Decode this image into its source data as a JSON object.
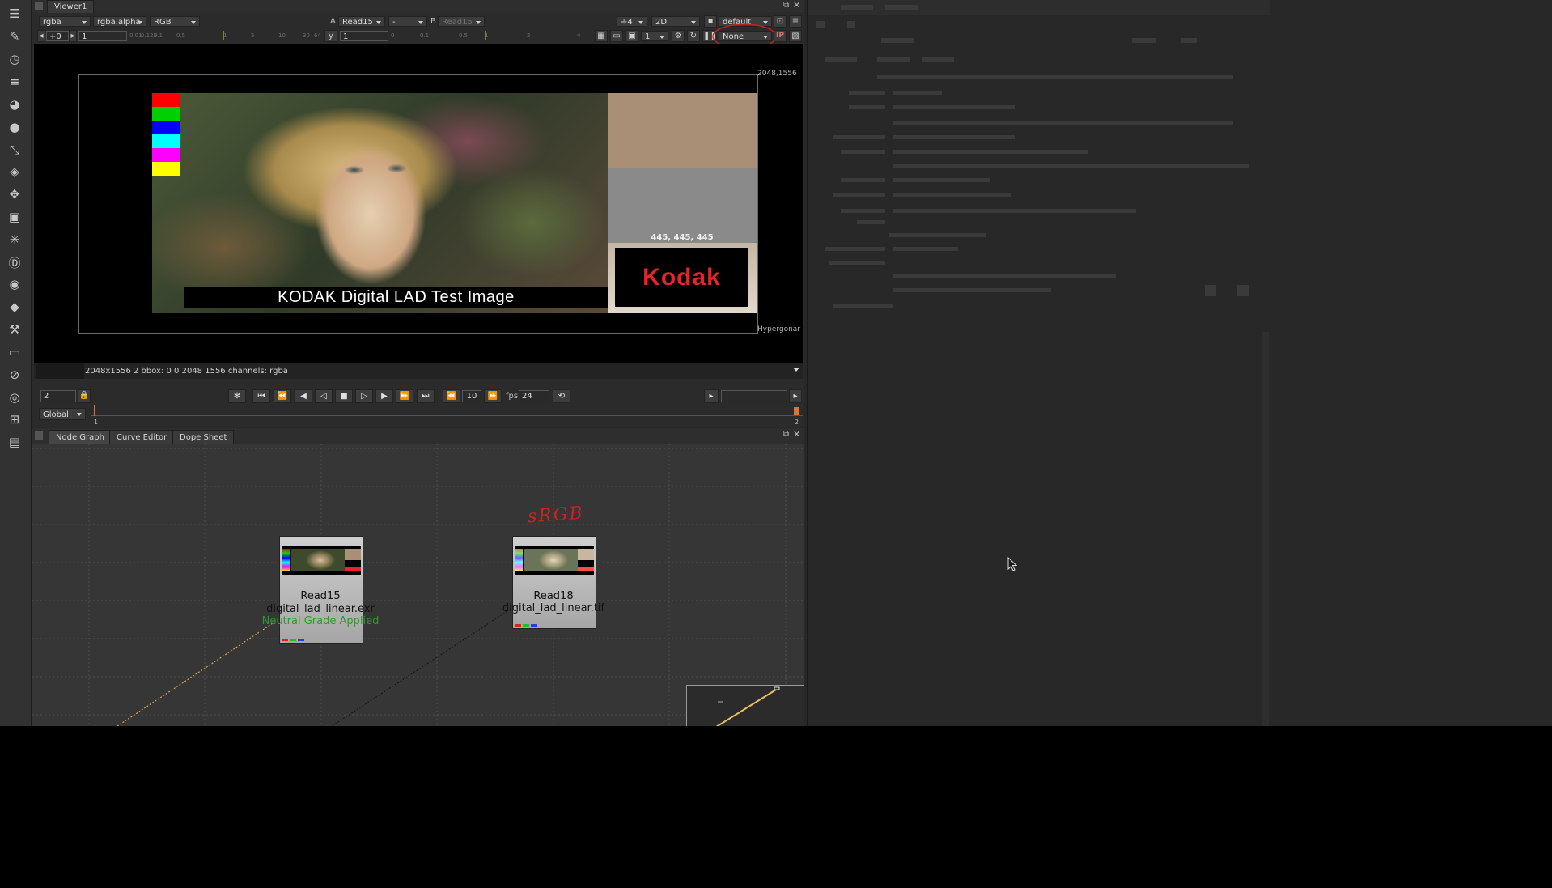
{
  "toolbar": {
    "icons": [
      "menu-icon",
      "paint-icon",
      "time-icon",
      "channels-icon",
      "color-icon",
      "filter-icon",
      "keyer-icon",
      "merge-icon",
      "transform-icon",
      "3d-icon",
      "particles-icon",
      "deep-icon",
      "views-icon",
      "metadata-icon",
      "toolsets-icon",
      "other-icon",
      "furnace-icon",
      "ofx-icon",
      "windows-icon",
      "file-icon"
    ]
  },
  "viewer": {
    "tab_label": "Viewer1",
    "channels": "rgba",
    "alpha": "rgba.alpha",
    "display": "RGB",
    "a_label": "A",
    "a_input": "Read15",
    "wipe": "-",
    "b_label": "B",
    "b_input": "Read15",
    "downscale": "÷4",
    "view_mode": "2D",
    "lut": "default",
    "gain_offset": "+0",
    "gain_value": "1",
    "gamma_label": "y",
    "gamma_value": "1",
    "gain_ticks": [
      "0.01",
      "0.125",
      "0.1",
      "0.5",
      "1",
      "5",
      "10",
      "30",
      "64"
    ],
    "gamma_ticks": [
      "0",
      "0.1",
      "0.5",
      "1",
      "2",
      "4"
    ],
    "proxy_value": "1",
    "roi": "None",
    "ip_label": "IP",
    "format_label": "2048,1556",
    "format_name": "Hypergonar",
    "image": {
      "caption": "KODAK Digital LAD Test Image",
      "patch_values": "445, 445, 445",
      "logo": "Kodak"
    },
    "status_info": "2048x1556 2 bbox: 0 0 2048 1556 channels: rgba"
  },
  "transport": {
    "frame": "2",
    "increment": "10",
    "fps_label": "fps",
    "fps": "24",
    "range_mode": "Global",
    "timeline_start": "1",
    "timeline_end": "2"
  },
  "nodegraph": {
    "tabs": [
      "Node Graph",
      "Curve Editor",
      "Dope Sheet"
    ],
    "annotation": "sRGB",
    "nodes": [
      {
        "name": "Read15",
        "file": "digital_lad_linear.exr",
        "note": "Neutral Grade Applied"
      },
      {
        "name": "Read18",
        "file": "digital_lad_linear.tif",
        "note": ""
      }
    ]
  },
  "colors": {
    "annotation_red": "#cc2222",
    "note_green": "#2e9a2e",
    "kodak_red": "#e8232a"
  }
}
